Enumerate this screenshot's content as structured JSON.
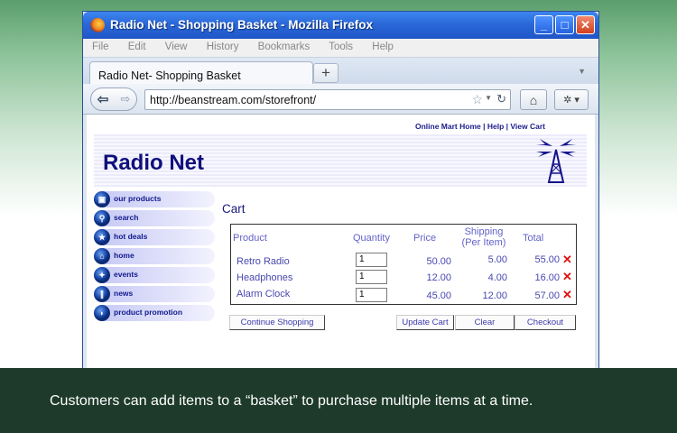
{
  "window": {
    "title": "Radio Net - Shopping Basket - Mozilla Firefox",
    "controls": {
      "minimize": "_",
      "maximize": "□",
      "close": "✕"
    }
  },
  "menu": [
    "File",
    "Edit",
    "View",
    "History",
    "Bookmarks",
    "Tools",
    "Help"
  ],
  "tab": {
    "label": "Radio Net- Shopping Basket",
    "new_tab": "+"
  },
  "address": {
    "url": "http://beanstream.com/storefront/"
  },
  "site": {
    "top_links": [
      "Online Mart Home",
      "Help",
      "View Cart"
    ],
    "brand": "Radio Net",
    "nav": [
      {
        "label": "our products",
        "icon": "products-icon"
      },
      {
        "label": "search",
        "icon": "search-icon"
      },
      {
        "label": "hot deals",
        "icon": "star-icon"
      },
      {
        "label": "home",
        "icon": "home-icon"
      },
      {
        "label": "events",
        "icon": "events-icon"
      },
      {
        "label": "news",
        "icon": "news-icon"
      },
      {
        "label": "product promotion",
        "icon": "promotion-icon"
      }
    ]
  },
  "cart": {
    "title": "Cart",
    "headers": {
      "product": "Product",
      "quantity": "Quantity",
      "price": "Price",
      "shipping_line1": "Shipping",
      "shipping_line2": "(Per Item)",
      "total": "Total"
    },
    "rows": [
      {
        "product": "Retro Radio",
        "quantity": "1",
        "price": "50.00",
        "shipping": "5.00",
        "total": "55.00"
      },
      {
        "product": "Headphones",
        "quantity": "1",
        "price": "12.00",
        "shipping": "4.00",
        "total": "16.00"
      },
      {
        "product": "Alarm Clock",
        "quantity": "1",
        "price": "45.00",
        "shipping": "12.00",
        "total": "57.00"
      }
    ],
    "remove_symbol": "✕",
    "buttons": {
      "continue": "Continue Shopping",
      "update": "Update Cart",
      "clear": "Clear",
      "checkout": "Checkout"
    }
  },
  "caption": "Customers can add items to a “basket” to purchase multiple items at a time."
}
